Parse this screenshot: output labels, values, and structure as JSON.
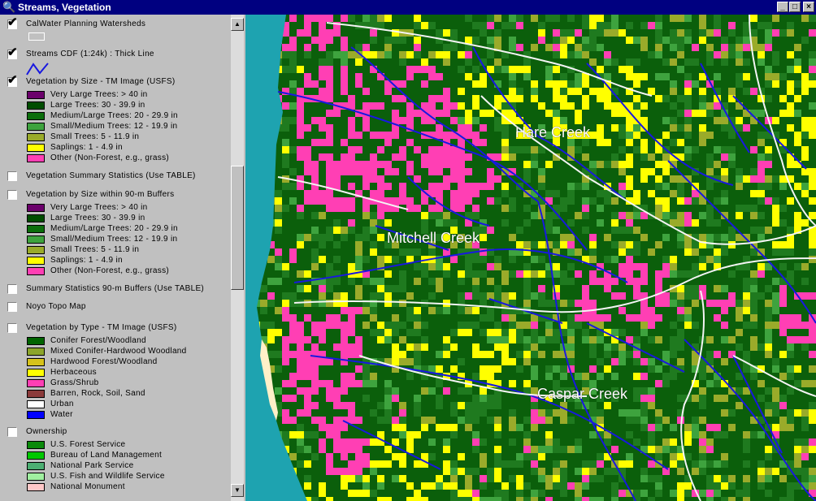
{
  "window": {
    "title": "Streams, Vegetation",
    "app_icon": "magnifier-icon",
    "minimize_glyph": "_",
    "maximize_glyph": "□",
    "close_glyph": "×"
  },
  "toc": {
    "layers": [
      {
        "name": "CalWater Planning Watersheds",
        "checked": true
      },
      {
        "name": "Streams CDF (1:24k) : Thick Line",
        "checked": true
      },
      {
        "name": "Vegetation by Size - TM Image (USFS)",
        "checked": true,
        "legend": [
          {
            "label": "Very Large Trees: > 40  in",
            "color": "#6b006b"
          },
          {
            "label": "Large Trees: 30 - 39.9 in",
            "color": "#004d00"
          },
          {
            "label": "Medium/Large Trees: 20 - 29.9 in",
            "color": "#0b6e0b"
          },
          {
            "label": "Small/Medium Trees: 12 - 19.9 in",
            "color": "#3ea33e"
          },
          {
            "label": "Small Trees: 5 - 11.9 in",
            "color": "#9aab2a"
          },
          {
            "label": "Saplings: 1 - 4.9 in",
            "color": "#ffff00"
          },
          {
            "label": "Other (Non-Forest, e.g., grass)",
            "color": "#ff3fb4"
          }
        ]
      },
      {
        "name": "Vegetation Summary Statistics (Use TABLE)",
        "checked": false
      },
      {
        "name": "Vegetation by Size within 90-m Buffers",
        "checked": false,
        "legend": [
          {
            "label": "Very Large Trees: > 40  in",
            "color": "#6b006b"
          },
          {
            "label": "Large Trees: 30 - 39.9 in",
            "color": "#004d00"
          },
          {
            "label": "Medium/Large Trees: 20 - 29.9 in",
            "color": "#0b6e0b"
          },
          {
            "label": "Small/Medium Trees: 12 - 19.9 in",
            "color": "#3ea33e"
          },
          {
            "label": "Small Trees: 5 - 11.9 in",
            "color": "#9aab2a"
          },
          {
            "label": "Saplings: 1 - 4.9 in",
            "color": "#ffff00"
          },
          {
            "label": "Other (Non-Forest, e.g., grass)",
            "color": "#ff3fb4"
          }
        ]
      },
      {
        "name": "Summary Statistics 90-m Buffers (Use TABLE)",
        "checked": false
      },
      {
        "name": "Noyo Topo Map",
        "checked": false
      },
      {
        "name": "Vegetation by Type - TM Image (USFS)",
        "checked": false,
        "legend": [
          {
            "label": "Conifer Forest/Woodland",
            "color": "#006400"
          },
          {
            "label": "Mixed Conifer-Hardwood Woodland",
            "color": "#8ca52a"
          },
          {
            "label": "Hardwood Forest/Woodland",
            "color": "#d6c21a"
          },
          {
            "label": "Herbaceous",
            "color": "#ffff00"
          },
          {
            "label": "Grass/Shrub",
            "color": "#ff3fb4"
          },
          {
            "label": "Barren, Rock, Soil, Sand",
            "color": "#8b3a3a"
          },
          {
            "label": "Urban",
            "color": "#ffffff"
          },
          {
            "label": "Water",
            "color": "#0000ff"
          }
        ]
      },
      {
        "name": "Ownership",
        "checked": false,
        "legend": [
          {
            "label": "U.S. Forest Service",
            "color": "#0a8a0a"
          },
          {
            "label": "Bureau of Land Management",
            "color": "#00c800"
          },
          {
            "label": "National Park Service",
            "color": "#4caf72"
          },
          {
            "label": "U.S. Fish and Wildlife Service",
            "color": "#a0f0a0"
          },
          {
            "label": "National Monument",
            "color": "#ffc8c8"
          }
        ]
      }
    ]
  },
  "map": {
    "labels": [
      "Hare Creek",
      "Mitchell Creek",
      "Caspar Creek"
    ],
    "colors": {
      "ocean": "#1ea3b0",
      "sand": "#fff0c8",
      "forest_dark": "#0b5f0b",
      "forest": "#1f7a1f",
      "small_trees": "#9aab2a",
      "saplings": "#ffff00",
      "other": "#ff3fb4",
      "stream": "#1818e0",
      "watershed_line": "#f4f4f4"
    }
  }
}
